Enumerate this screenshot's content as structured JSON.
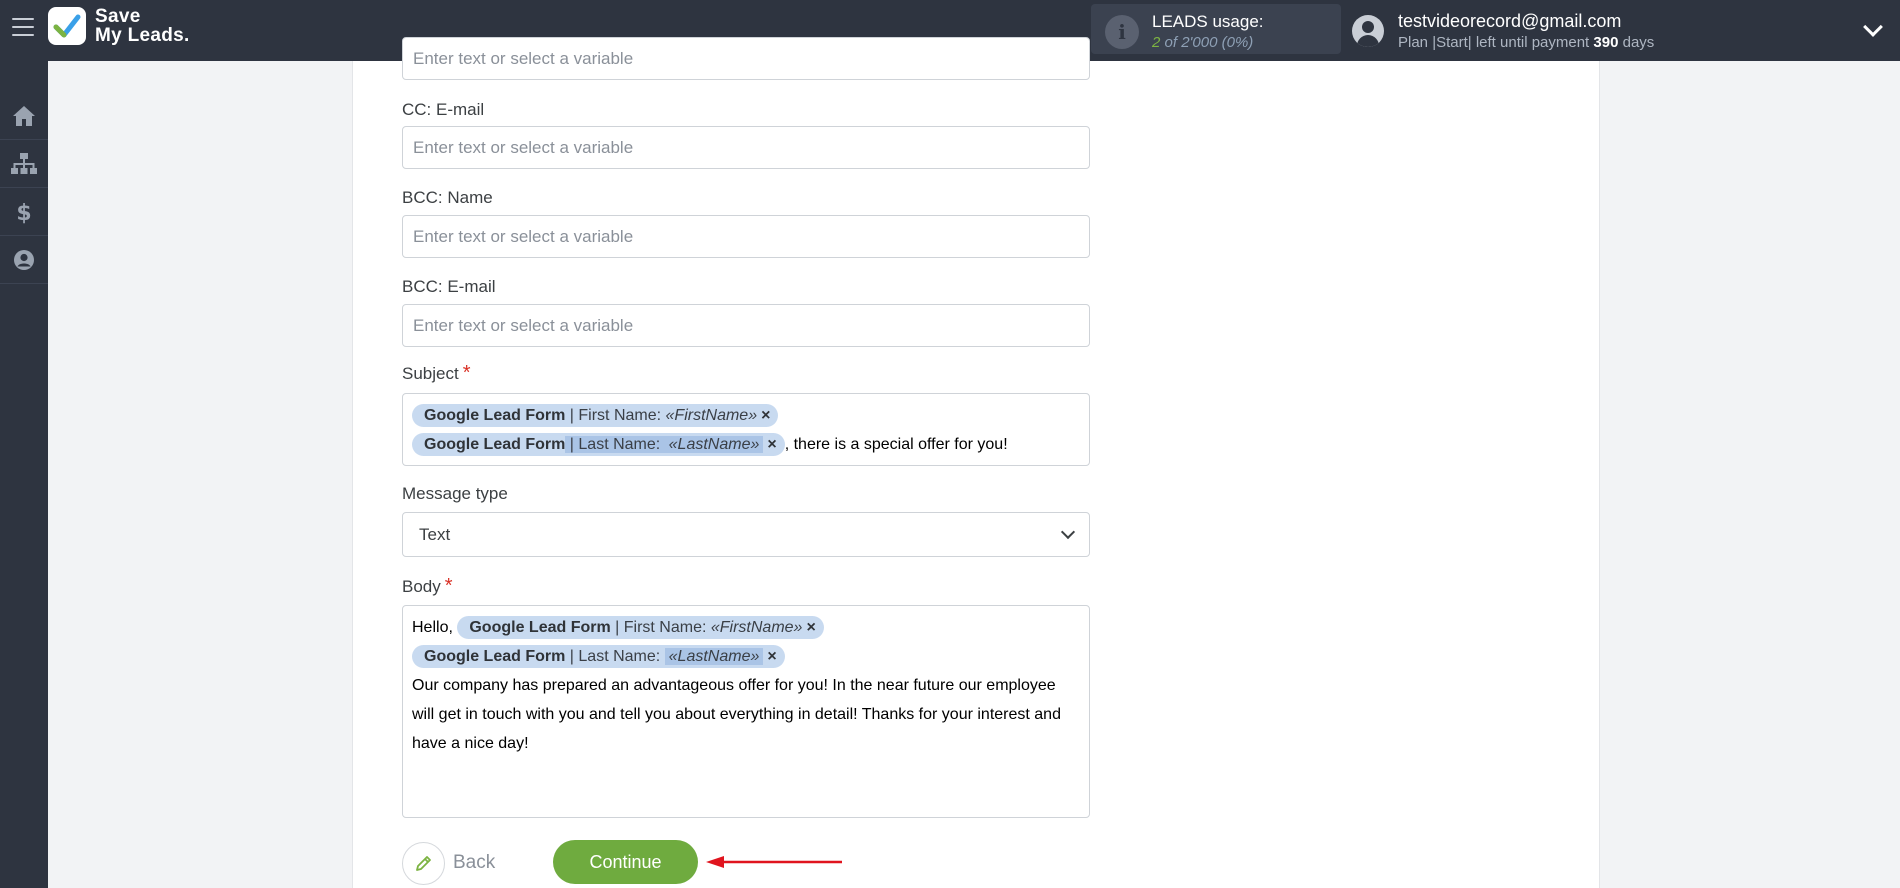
{
  "app": {
    "logo_line1": "Save",
    "logo_line2": "My Leads."
  },
  "usage": {
    "label": "LEADS usage:",
    "used": "2",
    "of_text": "of 2'000",
    "percent": "(0%)"
  },
  "account": {
    "email": "testvideorecord@gmail.com",
    "plan_prefix": "Plan |Start| left until payment",
    "days_value": "390",
    "days_suffix": "days"
  },
  "sidebar": {
    "items": [
      {
        "icon": "home-icon"
      },
      {
        "icon": "sitemap-icon"
      },
      {
        "icon": "dollar-icon"
      },
      {
        "icon": "user-circle-icon"
      }
    ]
  },
  "form": {
    "placeholder": "Enter text or select a variable",
    "cc_email_label": "CC: E-mail",
    "bcc_name_label": "BCC: Name",
    "bcc_email_label": "BCC: E-mail",
    "subject_label": "Subject",
    "required_mark": "*",
    "message_type_label": "Message type",
    "message_type_value": "Text",
    "body_label": "Body",
    "chips": {
      "source": "Google Lead Form",
      "first_name_field": " | First Name: ",
      "first_name_var": "«FirstName»",
      "last_name_field": " | Last Name: ",
      "last_name_var": "«LastName»",
      "remove": "×"
    },
    "subject_suffix": ", there is a special offer for you!",
    "body_greeting": "Hello,",
    "body_text": "Our company has prepared an advantageous offer for you! In the near future our employee will get in touch with you and tell you about everything in detail! Thanks for your interest and have a nice day!"
  },
  "actions": {
    "back_label": "Back",
    "continue_label": "Continue"
  },
  "colors": {
    "topbar": "#2e3440",
    "accent_green": "#6fab3f",
    "chip_blue": "#c8daf0",
    "annotation_red": "#e0141e"
  }
}
